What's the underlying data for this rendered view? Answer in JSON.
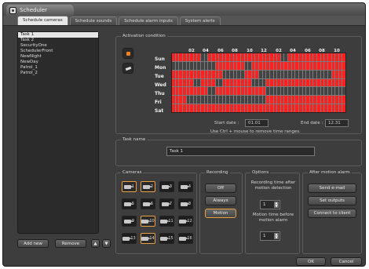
{
  "window": {
    "title": "Scheduler"
  },
  "tabs": [
    "Schedule cameras",
    "Schedule sounds",
    "Schedule alarm inputs",
    "System alerts"
  ],
  "active_tab": 0,
  "tasks": [
    "Task 1",
    "Task 2",
    "SecurityOne",
    "SchedulerFront",
    "NewNight",
    "NewDay",
    "Patrol_1",
    "Patrol_2"
  ],
  "selected_task": 0,
  "task_buttons": {
    "add": "Add new",
    "remove": "Remove"
  },
  "activation": {
    "label": "Activation condition",
    "hours": [
      "02",
      "04",
      "06",
      "08",
      "10",
      "12",
      "02",
      "04",
      "06",
      "08",
      "10"
    ],
    "days": [
      "Sun",
      "Mon",
      "Tue",
      "Wed",
      "Thu",
      "Fri",
      "Sat"
    ],
    "start_label": "Start date :",
    "start_value": "01.01",
    "end_label": "End date :",
    "end_value": "12.31",
    "hint": "Use Ctrl + mouse to remove time ranges."
  },
  "task_name": {
    "label": "Task name",
    "value": "Task 1"
  },
  "cameras": {
    "label": "Cameras",
    "numbers": [
      "1",
      "2",
      "3",
      "4",
      "5",
      "6",
      "7",
      "8",
      "9",
      "10",
      "11",
      "12",
      "13",
      "14",
      "15",
      "16"
    ],
    "selected": [
      1,
      2,
      10,
      14
    ]
  },
  "recording": {
    "label": "Recording",
    "buttons": [
      "Off",
      "Always",
      "Motion"
    ],
    "active": 2
  },
  "options": {
    "label": "Options",
    "after_label": "Recording time after motion detection",
    "after_value": "1",
    "before_label": "Motion time before motion alarm",
    "before_value": "1"
  },
  "after_alarm": {
    "label": "After motion alarm",
    "buttons": [
      "Send e-mail",
      "Set outputs",
      "Connect to client"
    ]
  },
  "footer": {
    "ok": "OK",
    "cancel": "Cancel"
  },
  "colors": {
    "active": "#ff2020",
    "inactive": "#444444"
  }
}
